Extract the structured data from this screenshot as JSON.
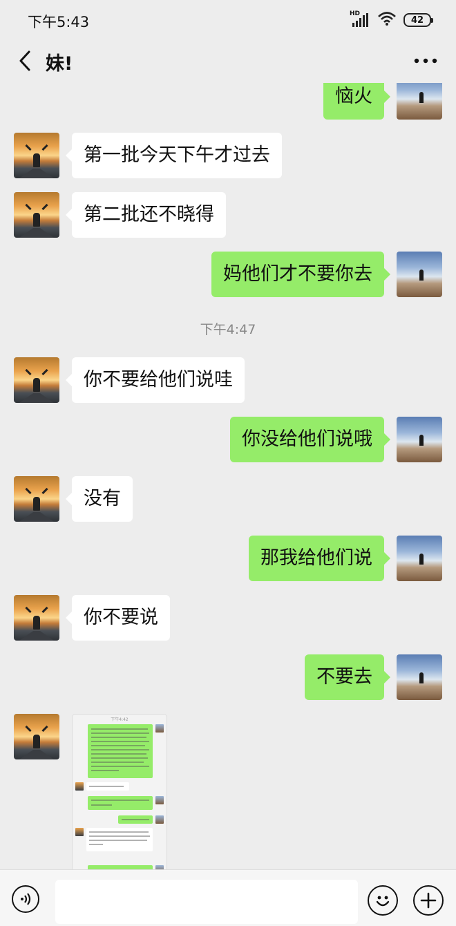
{
  "status": {
    "time": "下午5:43",
    "battery": "42",
    "network": "HD"
  },
  "header": {
    "title": "妹!"
  },
  "messages": [
    {
      "side": "right",
      "text": "恼火"
    },
    {
      "side": "left",
      "text": "第一批今天下午才过去"
    },
    {
      "side": "left",
      "text": "第二批还不晓得"
    },
    {
      "side": "right",
      "text": "妈他们才不要你去"
    },
    {
      "side": "left",
      "text": "你不要给他们说哇"
    },
    {
      "side": "right",
      "text": "你没给他们说哦"
    },
    {
      "side": "left",
      "text": "没有"
    },
    {
      "side": "right",
      "text": "那我给他们说"
    },
    {
      "side": "left",
      "text": "你不要说"
    },
    {
      "side": "right",
      "text": "不要去"
    }
  ],
  "timestamp": "下午4:47",
  "image_message": {
    "thumb_time": "下午4:42",
    "side": "left"
  },
  "icons": {
    "back": "back-arrow-icon",
    "more": "more-dots-icon",
    "voice": "voice-icon",
    "emoji": "emoji-icon",
    "plus": "plus-icon"
  },
  "colors": {
    "self_bubble": "#95ec69",
    "other_bubble": "#ffffff",
    "background": "#ededed"
  }
}
